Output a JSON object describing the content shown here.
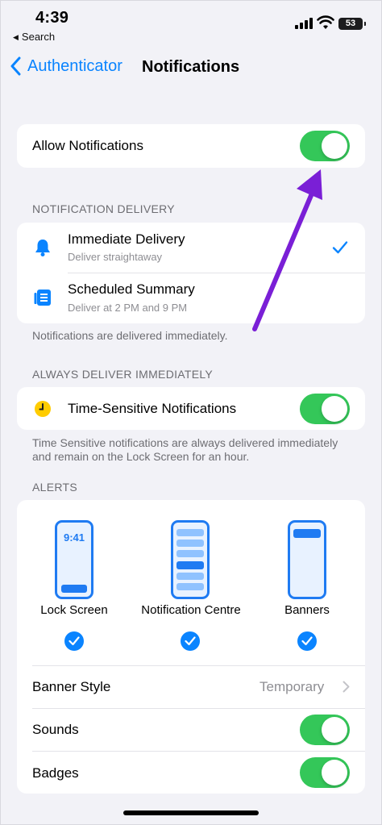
{
  "status_bar": {
    "time": "4:39",
    "back_app": "Search",
    "battery": "53"
  },
  "nav": {
    "back_label": "Authenticator",
    "title": "Notifications"
  },
  "allow": {
    "label": "Allow Notifications",
    "enabled": true
  },
  "delivery": {
    "header": "NOTIFICATION DELIVERY",
    "options": [
      {
        "title": "Immediate Delivery",
        "subtitle": "Deliver straightaway",
        "icon": "bell-icon",
        "selected": true
      },
      {
        "title": "Scheduled Summary",
        "subtitle": "Deliver at 2 PM and 9 PM",
        "icon": "summary-icon",
        "selected": false
      }
    ],
    "footnote": "Notifications are delivered immediately."
  },
  "always": {
    "header": "ALWAYS DELIVER IMMEDIATELY",
    "label": "Time-Sensitive Notifications",
    "enabled": true,
    "footnote": "Time Sensitive notifications are always delivered immediately and remain on the Lock Screen for an hour."
  },
  "alerts": {
    "header": "ALERTS",
    "styles": [
      {
        "label": "Lock Screen",
        "phone_time": "9:41",
        "checked": true
      },
      {
        "label": "Notification Centre",
        "checked": true
      },
      {
        "label": "Banners",
        "checked": true
      }
    ],
    "banner_style_label": "Banner Style",
    "banner_style_value": "Temporary",
    "sounds_label": "Sounds",
    "sounds_enabled": true,
    "badges_label": "Badges",
    "badges_enabled": true
  },
  "colors": {
    "accent": "#0a84ff",
    "toggle_on": "#34c759",
    "annotation_arrow": "#7a1fd6",
    "clock_icon": "#ffcc00"
  }
}
